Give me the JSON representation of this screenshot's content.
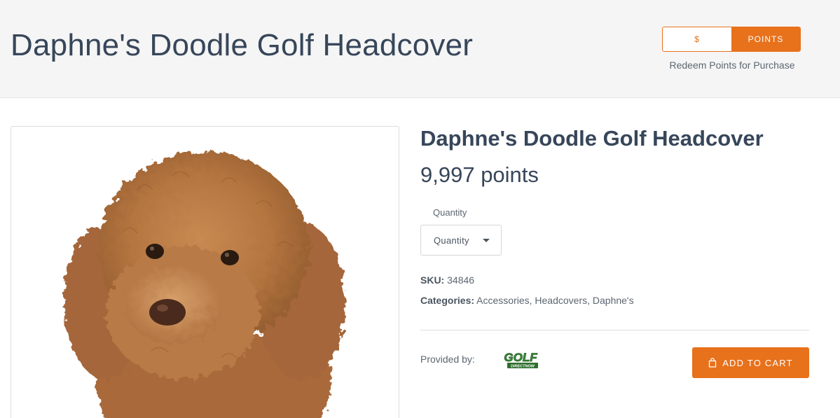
{
  "header": {
    "title": "Daphne's Doodle Golf Headcover",
    "currency_toggle": {
      "dollar_label": "$",
      "points_label": "POINTS",
      "selected": "POINTS"
    },
    "caption": "Redeem Points for Purchase"
  },
  "product": {
    "name": "Daphne's Doodle Golf Headcover",
    "price": "9,997 points",
    "image_icon": "plush-dog-headcover-image",
    "quantity": {
      "label": "Quantity",
      "selected": "Quantity"
    },
    "sku_label": "SKU:",
    "sku_value": "34846",
    "categories_label": "Categories:",
    "categories_value": "Accessories, Headcovers, Daphne's",
    "provided_by_label": "Provided by:",
    "provider_logo": {
      "text_main": "GOLF",
      "text_sub": "DIRECTNOW"
    },
    "add_to_cart_label": "ADD TO CART"
  },
  "colors": {
    "accent": "#e8711b",
    "title": "#37465a",
    "header_bg": "#f5f5f5",
    "logo_green": "#3a9a3a"
  }
}
